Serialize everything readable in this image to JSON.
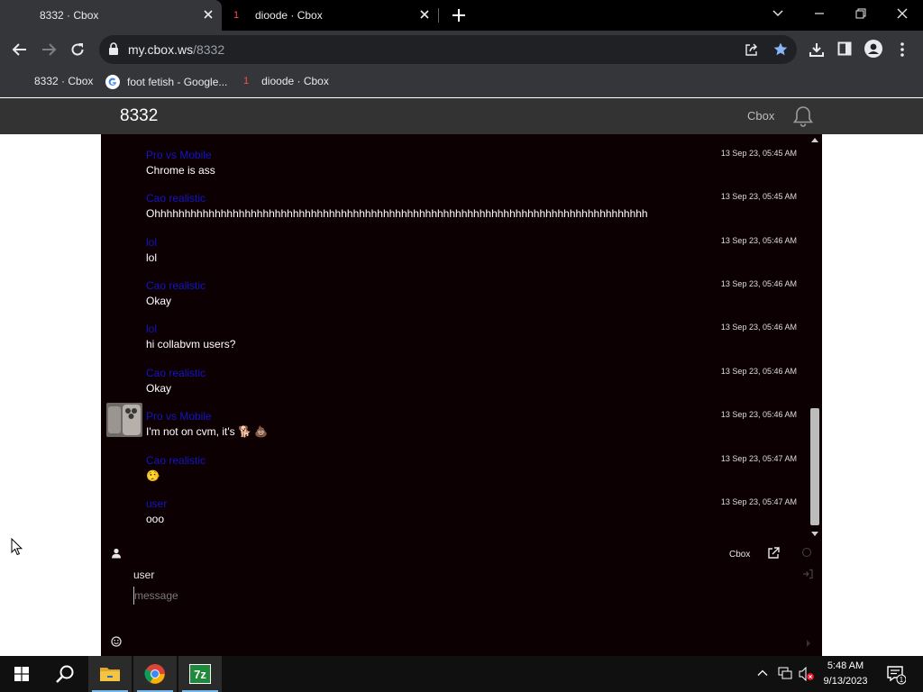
{
  "browser": {
    "tabs": [
      {
        "title": "8332 · Cbox",
        "active": true
      },
      {
        "title": "dioode · Cbox",
        "active": false,
        "badge": "1"
      }
    ],
    "url": {
      "host": "my.cbox.ws",
      "path": "/8332"
    },
    "bookmarks": [
      {
        "label": "8332 · Cbox",
        "icon": "cbox-icon"
      },
      {
        "label": "foot fetish - Google...",
        "icon": "google-icon"
      },
      {
        "label": "dioode · Cbox",
        "icon": "cbox-icon",
        "badge": "1"
      }
    ]
  },
  "cbox": {
    "room_title": "8332",
    "brand_link": "Cbox",
    "colors": {
      "background": "#0d0002",
      "author": "#1414c8",
      "header": "#333333"
    }
  },
  "messages": [
    {
      "author": "Pro vs Mobile",
      "time": "13 Sep 23, 05:45 AM",
      "text": "Chrome is ass"
    },
    {
      "author": "Cao realistic",
      "time": "13 Sep 23, 05:45 AM",
      "text": "Ohhhhhhhhhhhhhhhhhhhhhhhhhhhhhhhhhhhhhhhhhhhhhhhhhhhhhhhhhhhhhhhhhhhhhhhhhhhhhhhhhh"
    },
    {
      "author": "lol",
      "time": "13 Sep 23, 05:46 AM",
      "text": "lol"
    },
    {
      "author": "Cao realistic",
      "time": "13 Sep 23, 05:46 AM",
      "text": "Okay"
    },
    {
      "author": "lol",
      "time": "13 Sep 23, 05:46 AM",
      "text": "hi collabvm users?"
    },
    {
      "author": "Cao realistic",
      "time": "13 Sep 23, 05:46 AM",
      "text": "Okay"
    },
    {
      "author": "Pro vs Mobile",
      "time": "13 Sep 23, 05:46 AM",
      "text": "I'm not on cvm, it's 🐕 💩",
      "has_avatar": true
    },
    {
      "author": "Cao realistic",
      "time": "13 Sep 23, 05:47 AM",
      "text": "🤥"
    },
    {
      "author": "user",
      "time": "13 Sep 23, 05:47 AM",
      "text": "ooo"
    }
  ],
  "form": {
    "name_value": "user",
    "message_placeholder": "message",
    "message_value": "",
    "cbox_link": "Cbox"
  },
  "taskbar": {
    "apps": [
      "file-explorer-icon",
      "chrome-icon",
      "7zip-icon"
    ],
    "seven_zip_label": "7z",
    "time": "5:48 AM",
    "date": "9/13/2023",
    "notification_count": "1"
  }
}
